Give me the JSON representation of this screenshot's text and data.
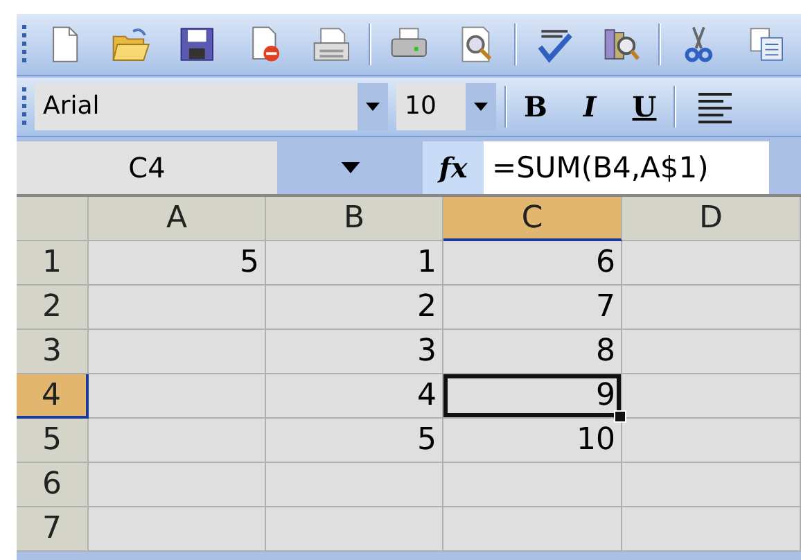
{
  "font_toolbar": {
    "font_name": "Arial",
    "font_size": "10",
    "format_buttons": [
      {
        "label": "B",
        "kind": "bold"
      },
      {
        "label": "I",
        "kind": "italic"
      },
      {
        "label": "U",
        "kind": "underline"
      }
    ]
  },
  "formula_bar": {
    "name_box": "C4",
    "function_button": "fx",
    "formula": "=SUM(B4,A$1)"
  },
  "sheet": {
    "columns": [
      {
        "label": "A",
        "selected": false
      },
      {
        "label": "B",
        "selected": false
      },
      {
        "label": "C",
        "selected": true
      },
      {
        "label": "D",
        "selected": false
      }
    ],
    "rows": [
      {
        "header": "1",
        "selected": false,
        "cells": [
          {
            "value": "5",
            "selected": false
          },
          {
            "value": "1",
            "selected": false
          },
          {
            "value": "6",
            "selected": false
          },
          {
            "selected": false
          }
        ]
      },
      {
        "header": "2",
        "selected": false,
        "cells": [
          {
            "selected": false
          },
          {
            "value": "2",
            "selected": false
          },
          {
            "value": "7",
            "selected": false
          },
          {
            "selected": false
          }
        ]
      },
      {
        "header": "3",
        "selected": false,
        "cells": [
          {
            "selected": false
          },
          {
            "value": "3",
            "selected": false
          },
          {
            "value": "8",
            "selected": false
          },
          {
            "selected": false
          }
        ]
      },
      {
        "header": "4",
        "selected": true,
        "cells": [
          {
            "selected": false
          },
          {
            "value": "4",
            "selected": false
          },
          {
            "value": "9",
            "selected": true
          },
          {
            "selected": false
          }
        ]
      },
      {
        "header": "5",
        "selected": false,
        "cells": [
          {
            "selected": false
          },
          {
            "value": "5",
            "selected": false
          },
          {
            "value": "10",
            "selected": false
          },
          {
            "selected": false
          }
        ]
      },
      {
        "header": "6",
        "selected": false,
        "cells": [
          {
            "selected": false
          },
          {
            "selected": false
          },
          {
            "selected": false
          },
          {
            "selected": false
          }
        ]
      },
      {
        "header": "7",
        "selected": false,
        "cells": [
          {
            "selected": false
          },
          {
            "selected": false
          },
          {
            "selected": false
          },
          {
            "selected": false
          }
        ]
      }
    ]
  }
}
